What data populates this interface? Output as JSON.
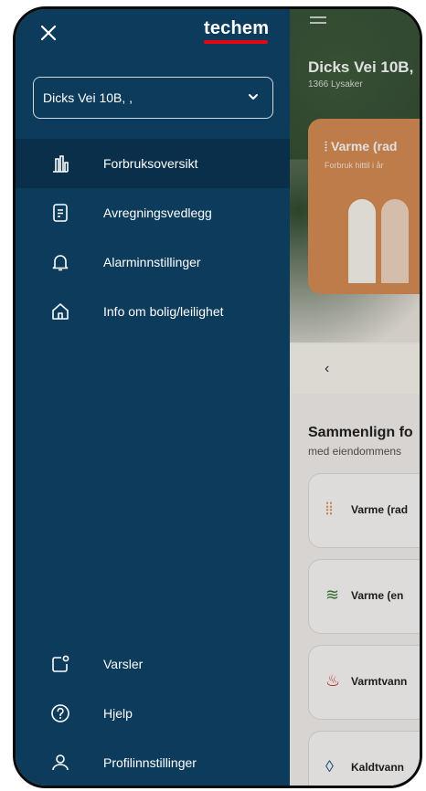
{
  "background": {
    "address_title": "Dicks Vei 10B,",
    "address_sub": "1366 Lysaker",
    "card": {
      "title": "Varme (rad",
      "subtitle": "Forbruk hittil i år",
      "icon": "radiator-icon"
    },
    "section_title": "Sammenlign fo",
    "section_sub": "med eiendommens",
    "compare_items": [
      {
        "label": "Varme (rad",
        "icon": "radiator-icon"
      },
      {
        "label": "Varme (en",
        "icon": "heat-waves-icon"
      },
      {
        "label": "Varmtvann",
        "icon": "hot-water-drop-icon"
      },
      {
        "label": "Kaldtvann",
        "icon": "water-drop-icon"
      }
    ]
  },
  "drawer": {
    "logo_text": "techem",
    "property_select": {
      "value": "Dicks Vei 10B, ,",
      "icon": "chevron-down-icon"
    },
    "menu": [
      {
        "label": "Forbruksoversikt",
        "icon": "bar-chart-icon",
        "active": true
      },
      {
        "label": "Avregningsvedlegg",
        "icon": "document-icon",
        "active": false
      },
      {
        "label": "Alarminnstillinger",
        "icon": "bell-icon",
        "active": false
      },
      {
        "label": "Info om bolig/leilighet",
        "icon": "home-icon",
        "active": false
      }
    ],
    "bottom_menu": [
      {
        "label": "Varsler",
        "icon": "notification-icon"
      },
      {
        "label": "Hjelp",
        "icon": "help-icon"
      },
      {
        "label": "Profilinnstillinger",
        "icon": "user-icon"
      }
    ]
  },
  "colors": {
    "drawer_bg": "#0d3b5c",
    "active_item_bg": "#0a2f4a",
    "brand_red": "#e30613",
    "card_orange": "#d98e56"
  }
}
